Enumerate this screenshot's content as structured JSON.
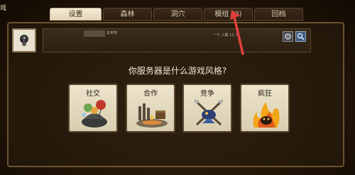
{
  "window": {
    "title": "戏"
  },
  "tabs": [
    {
      "label": "设置",
      "active": true
    },
    {
      "label": "森林",
      "active": false
    },
    {
      "label": "洞穴",
      "active": false
    },
    {
      "label": "模组",
      "count": "(0)",
      "active": false
    },
    {
      "label": "回档",
      "active": false
    }
  ],
  "host": {
    "meta": "玄丰符",
    "info": "一个 人数 11 个"
  },
  "question": "你服务器是什么游戏风格?",
  "styles": [
    {
      "label": "社交",
      "icon": "social-icon"
    },
    {
      "label": "合作",
      "icon": "cooperative-icon"
    },
    {
      "label": "竞争",
      "icon": "competitive-icon"
    },
    {
      "label": "疯狂",
      "icon": "madness-icon"
    }
  ],
  "colors": {
    "accent": "#e0403c",
    "card": "#e6ddc4",
    "panel_border": "#6b5432"
  }
}
